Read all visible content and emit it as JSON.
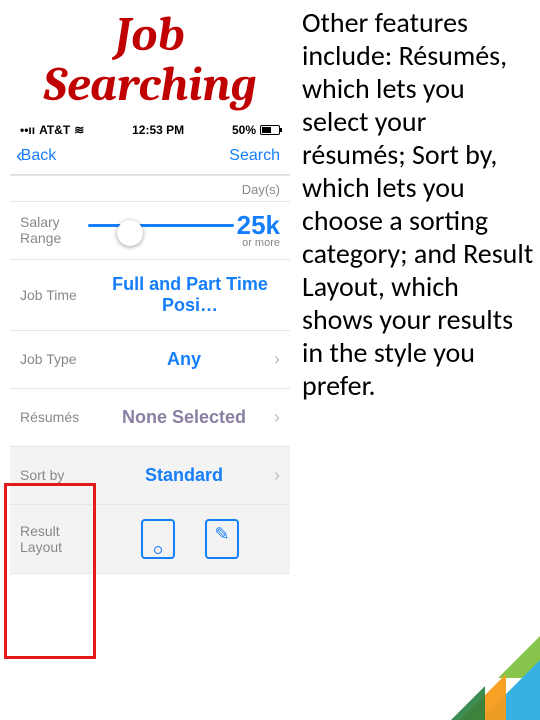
{
  "title_line1": "Job",
  "title_line2": "Searching",
  "status": {
    "carrier": "AT&T",
    "wifi_glyph": "≋",
    "time": "12:53 PM",
    "battery_pct": "50%"
  },
  "nav": {
    "back": "Back",
    "search": "Search"
  },
  "rows": {
    "days_hint": "Day(s)",
    "salary_label": "Salary Range",
    "salary_value": "25k",
    "salary_sub": "or more",
    "jobtime_label": "Job Time",
    "jobtime_value": "Full and Part Time Posi…",
    "jobtype_label": "Job Type",
    "jobtype_value": "Any",
    "resumes_label": "Résumés",
    "resumes_value": "None Selected",
    "sortby_label": "Sort by",
    "sortby_value": "Standard",
    "layout_label": "Result Layout"
  },
  "right_text": "Other features include: Résumés, which lets you select your résumés; Sort by, which lets you choose a sorting category; and Result Layout, which shows your results in the style you prefer."
}
